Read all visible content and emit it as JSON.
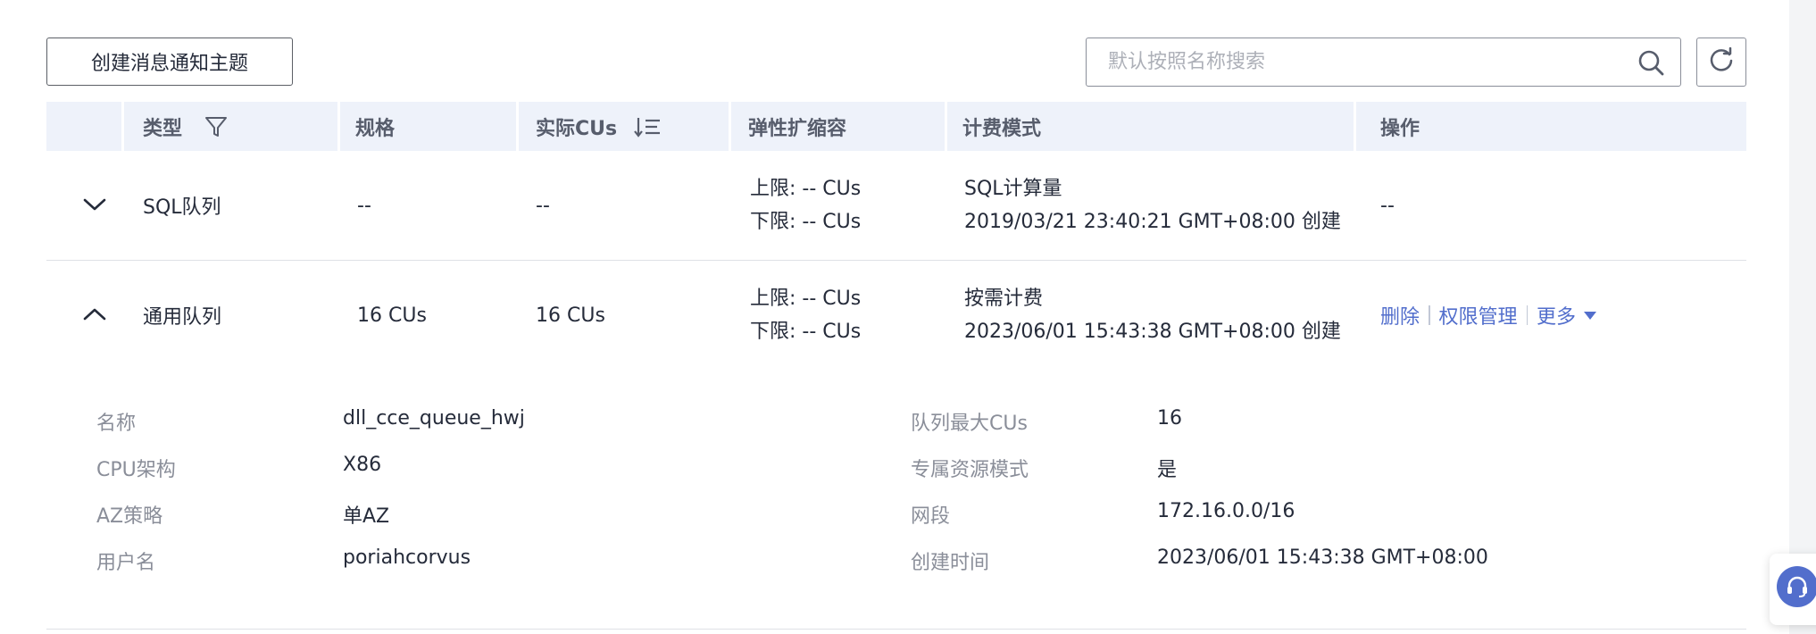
{
  "toolbar": {
    "create_label": "创建消息通知主题",
    "search_placeholder": "默认按照名称搜索"
  },
  "table": {
    "headers": {
      "type": "类型",
      "spec": "规格",
      "actual_cus": "实际CUs",
      "elastic": "弹性扩缩容",
      "billing": "计费模式",
      "ops": "操作"
    },
    "rows": [
      {
        "type": "SQL队列",
        "spec": "--",
        "actual_cus": "--",
        "elastic_upper": "上限: -- CUs",
        "elastic_lower": "下限: -- CUs",
        "billing_mode": "SQL计算量",
        "billing_created": "2019/03/21 23:40:21 GMT+08:00 创建",
        "ops": "--",
        "expanded": false
      },
      {
        "type": "通用队列",
        "spec": "16 CUs",
        "actual_cus": "16 CUs",
        "elastic_upper": "上限: -- CUs",
        "elastic_lower": "下限: -- CUs",
        "billing_mode": "按需计费",
        "billing_created": "2023/06/01 15:43:38 GMT+08:00 创建",
        "op_delete": "删除",
        "op_permission": "权限管理",
        "op_more": "更多",
        "expanded": true
      }
    ]
  },
  "detail": {
    "left": [
      {
        "label": "名称",
        "value": "dll_cce_queue_hwj"
      },
      {
        "label": "CPU架构",
        "value": "X86"
      },
      {
        "label": "AZ策略",
        "value": "单AZ"
      },
      {
        "label": "用户名",
        "value": "poriahcorvus"
      }
    ],
    "right": [
      {
        "label": "队列最大CUs",
        "value": "16"
      },
      {
        "label": "专属资源模式",
        "value": "是"
      },
      {
        "label": "网段",
        "value": "172.16.0.0/16"
      },
      {
        "label": "创建时间",
        "value": "2023/06/01 15:43:38 GMT+08:00"
      }
    ]
  },
  "icons": {
    "filter": "filter-icon",
    "sort": "sort-icon",
    "search": "search-icon",
    "refresh": "refresh-icon",
    "expand": "chevron-down-icon",
    "collapse": "chevron-up-icon",
    "more": "caret-down-icon",
    "help": "headset-icon"
  },
  "colors": {
    "link": "#526ecc",
    "header_bg": "#eef2fa"
  }
}
